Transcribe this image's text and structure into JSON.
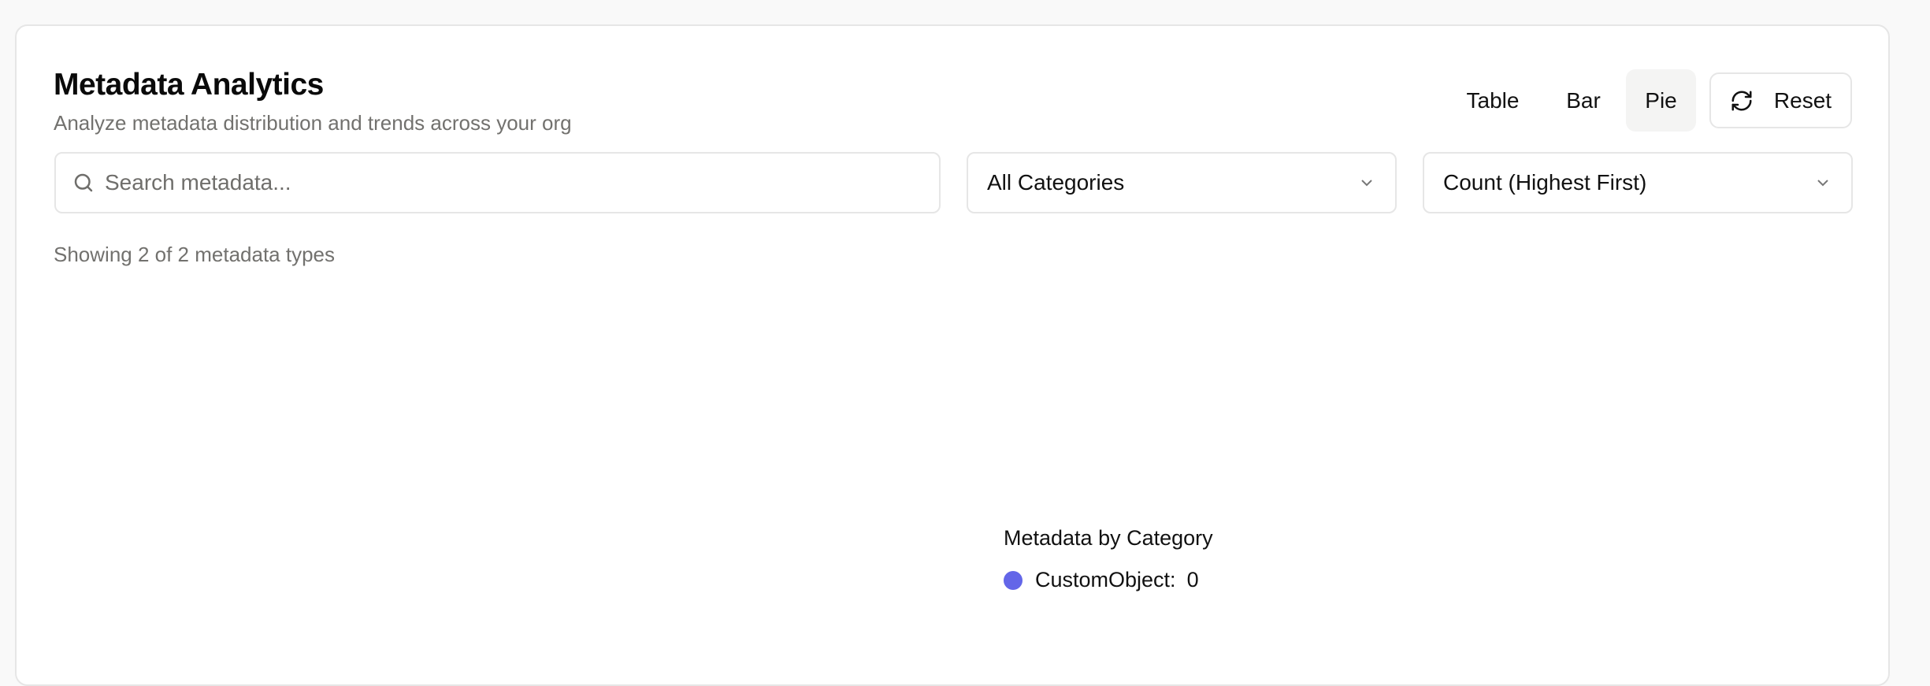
{
  "header": {
    "title": "Metadata Analytics",
    "subtitle": "Analyze metadata distribution and trends across your org"
  },
  "view_toggle": {
    "options": [
      "Table",
      "Bar",
      "Pie"
    ],
    "active": "Pie"
  },
  "reset_label": "Reset",
  "search": {
    "placeholder": "Search metadata...",
    "value": ""
  },
  "category_filter": {
    "selected": "All Categories"
  },
  "sort": {
    "selected": "Count (Highest First)"
  },
  "status": "Showing 2 of 2 metadata types",
  "colors": {
    "accent": "#6366e8"
  },
  "chart_data": {
    "type": "pie",
    "title": "Metadata by Category",
    "categories": [
      "CustomObject"
    ],
    "values": [
      0
    ],
    "legend_placement": "center",
    "legend": [
      {
        "label": "CustomObject:",
        "value": "0",
        "color": "#6366e8"
      }
    ]
  }
}
